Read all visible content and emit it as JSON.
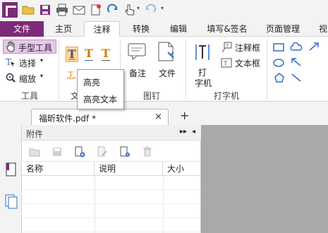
{
  "quick_access": {
    "icons": [
      "app-logo",
      "open-folder-icon",
      "save-icon",
      "print-icon",
      "email-icon",
      "new-document-icon",
      "redo-icon",
      "hand-pointer-icon",
      "undo-icon",
      "customize-qat-icon"
    ]
  },
  "tabs": {
    "file": "文件",
    "items": [
      "主页",
      "注释",
      "转换",
      "编辑",
      "填写&签名",
      "页面管理",
      "视"
    ],
    "active": "注释"
  },
  "ribbon": {
    "tools_group": {
      "hand_tool": "手型工具",
      "select": "选择",
      "zoom": "缩放",
      "label": "工具"
    },
    "text_markup_group": {
      "label_visible": "文",
      "glyphs": [
        "T",
        "T",
        "T"
      ]
    },
    "pin_group": {
      "note": "备注",
      "file": "文件",
      "label": "图钉"
    },
    "typewriter_group": {
      "typewriter_line1": "打",
      "typewriter_line2": "字机",
      "callout": "注释框",
      "textbox": "文本框",
      "label": "打字机"
    },
    "shapes": [
      "rectangle-icon",
      "cloud-icon",
      "arrow-icon",
      "oval-icon",
      "arrow-up-left-icon",
      "pentagon-icon",
      "line-icon"
    ]
  },
  "dropdown": {
    "items": [
      "高亮",
      "高亮文本"
    ]
  },
  "document_tabs": {
    "active_label": "福昕软件.pdf *",
    "close_glyph": "×",
    "new_tab_glyph": "+"
  },
  "attachments_panel": {
    "title": "附件",
    "columns": [
      "名称",
      "说明",
      "大小"
    ]
  },
  "colors": {
    "brand": "#7c2b78",
    "accent_orange": "#e89a2c",
    "workspace": "#a9a9a9"
  }
}
